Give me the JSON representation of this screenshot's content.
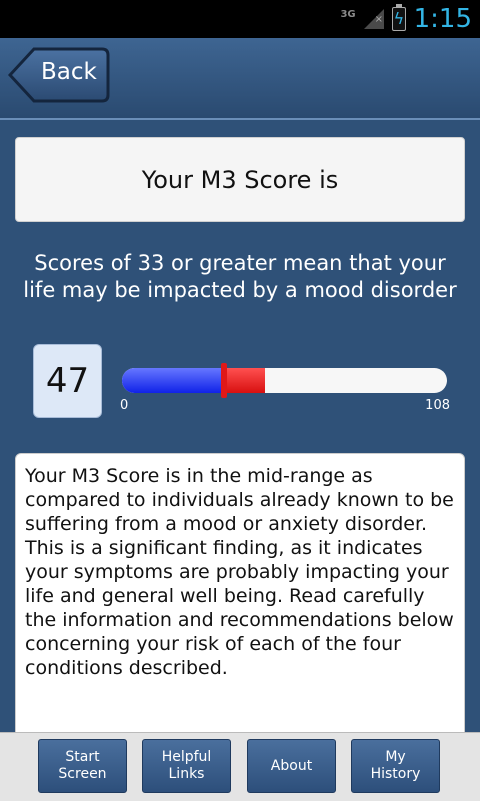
{
  "status": {
    "network": "3G",
    "time": "1:15"
  },
  "header": {
    "back_label": "Back"
  },
  "score_title": "Your M3 Score is",
  "explanation": "Scores of 33 or greater mean that your life may be impacted by a mood disorder",
  "score": {
    "value": "47",
    "min_label": "0",
    "max_label": "108",
    "fill_fraction": 0.435,
    "red_end_fraction": 0.44
  },
  "result_text": "Your M3 Score is in the mid-range as compared to individuals already known to be suffering from a mood or anxiety disorder. This is a significant finding, as it indicates your symptoms are probably impacting your life and general well being. Read carefully the information and recommendations below concerning your risk of each of the four conditions described.",
  "nav": [
    {
      "label": "Start\nScreen"
    },
    {
      "label": "Helpful\nLinks"
    },
    {
      "label": "About"
    },
    {
      "label": "My\nHistory"
    }
  ]
}
